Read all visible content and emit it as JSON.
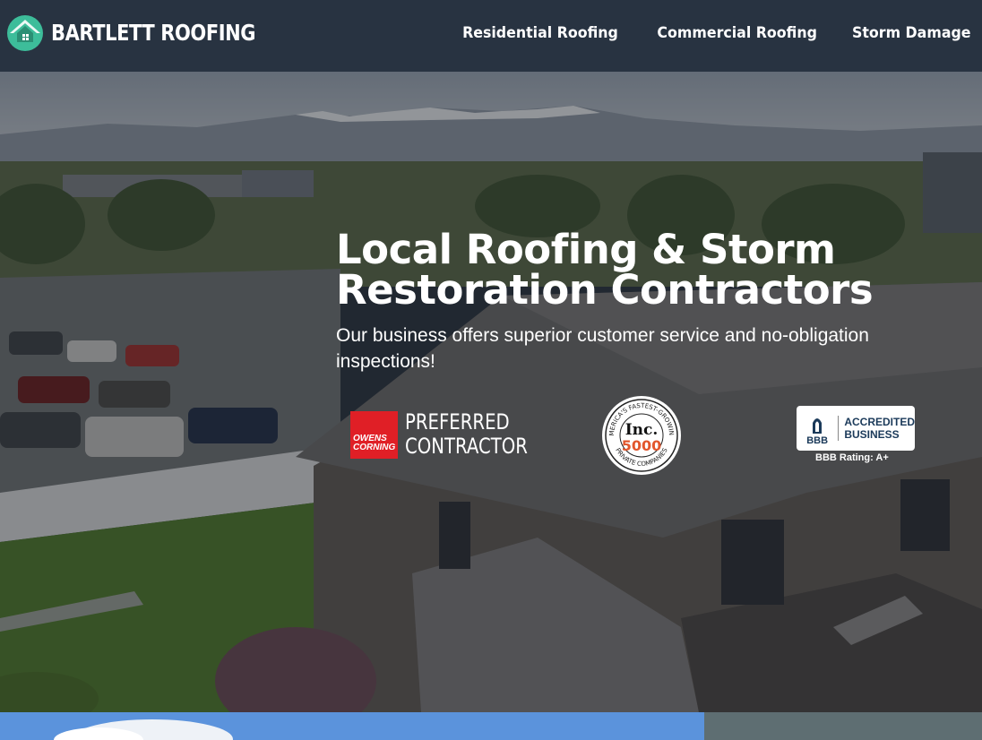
{
  "header": {
    "brand_name": "BARTLETT ROOFING",
    "logo_icon": "house-roof-icon",
    "nav": [
      {
        "label": "Residential Roofing"
      },
      {
        "label": "Commercial Roofing"
      },
      {
        "label": "Storm Damage"
      }
    ]
  },
  "hero": {
    "title_line1": "Local Roofing & Storm",
    "title_line2": "Restoration Contractors",
    "subtitle": "Our business offers superior customer service and no-obligation inspections!"
  },
  "badges": {
    "owens_corning": {
      "logo_word1": "OWENS",
      "logo_word2": "CORNING",
      "line1": "PREFERRED",
      "line2": "CONTRACTOR"
    },
    "inc5000": {
      "ring_top": "AMERICA'S FASTEST-GROWING",
      "brand": "Inc.",
      "number": "5000",
      "ring_bottom": "PRIVATE COMPANIES"
    },
    "bbb": {
      "mark": "BBB",
      "line1": "ACCREDITED",
      "line2": "BUSINESS",
      "rating": "BBB Rating: A+"
    }
  },
  "colors": {
    "header_bg": "#283341",
    "logo_teal": "#3dbd9a",
    "owens_red": "#e01f26"
  }
}
